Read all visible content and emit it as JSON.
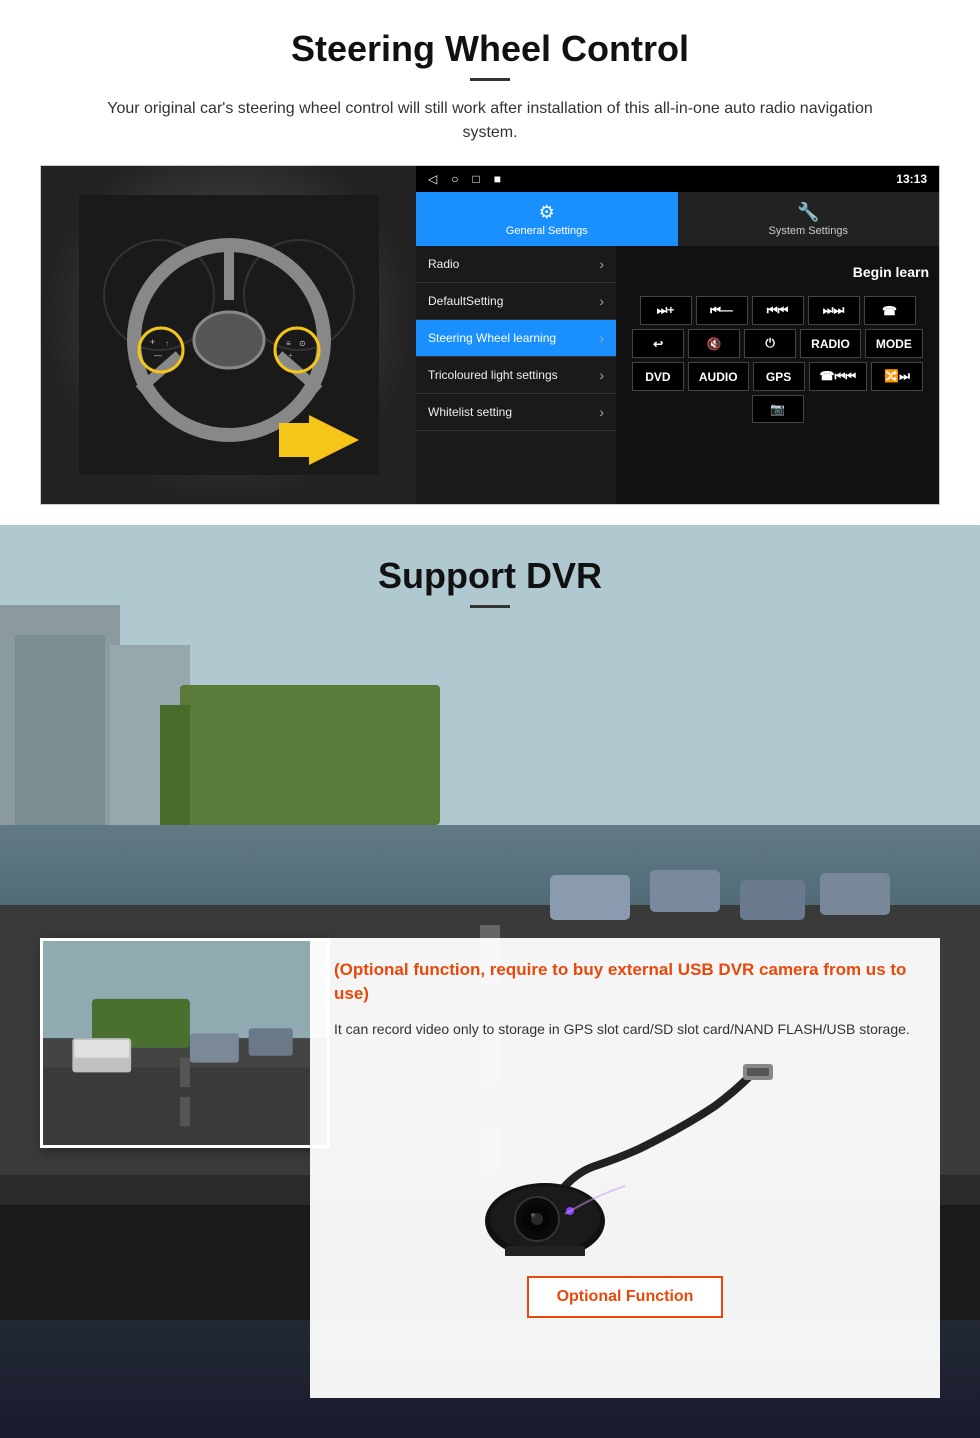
{
  "steering": {
    "title": "Steering Wheel Control",
    "description": "Your original car's steering wheel control will still work after installation of this all-in-one auto radio navigation system.",
    "statusbar": {
      "time": "13:13",
      "nav_icons": [
        "◁",
        "○",
        "□",
        "■"
      ]
    },
    "tabs": {
      "general": {
        "label": "General Settings",
        "icon": "⚙"
      },
      "system": {
        "label": "System Settings",
        "icon": "🔧"
      }
    },
    "menu_items": [
      {
        "label": "Radio",
        "active": false
      },
      {
        "label": "DefaultSetting",
        "active": false
      },
      {
        "label": "Steering Wheel learning",
        "active": true
      },
      {
        "label": "Tricoloured light settings",
        "active": false
      },
      {
        "label": "Whitelist setting",
        "active": false
      }
    ],
    "begin_learn": "Begin learn",
    "control_rows": [
      [
        "⏭+",
        "⏮-",
        "⏮⏮",
        "⏭⏭",
        "📞"
      ],
      [
        "📞",
        "🔇",
        "⏻",
        "RADIO",
        "MODE"
      ],
      [
        "DVD",
        "AUDIO",
        "GPS",
        "📞⏮⏮",
        "🔀⏭⏭"
      ]
    ],
    "ctrl_row1": [
      "⏭+",
      "⏮—",
      "⏮⏮",
      "⏭⏭",
      "☎"
    ],
    "ctrl_row2": [
      "↩",
      "🔇",
      "⏻",
      "RADIO",
      "MODE"
    ],
    "ctrl_row3": [
      "DVD",
      "AUDIO",
      "GPS",
      "☎⏮⏮",
      "🔀⏭"
    ]
  },
  "dvr": {
    "title": "Support DVR",
    "info_title": "(Optional function, require to buy external USB DVR camera from us to use)",
    "info_text": "It can record video only to storage in GPS slot card/SD slot card/NAND FLASH/USB storage.",
    "optional_btn": "Optional Function"
  }
}
